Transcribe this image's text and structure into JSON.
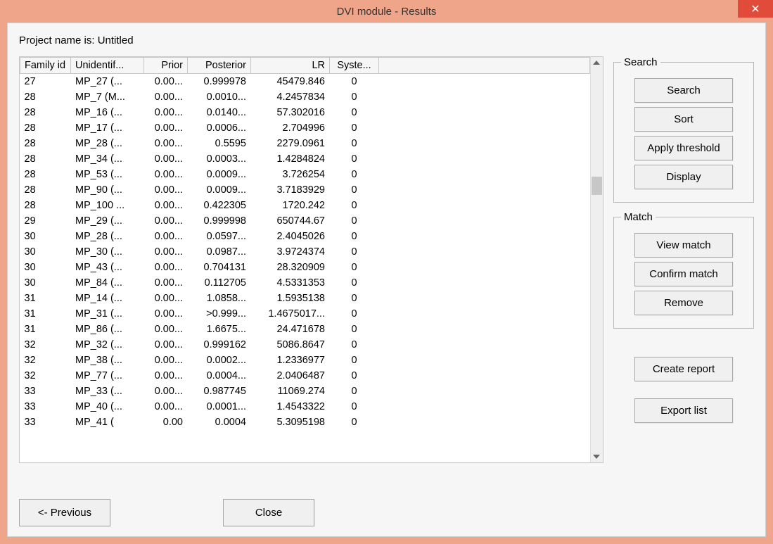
{
  "window": {
    "title": "DVI module - Results",
    "close_glyph": "✕"
  },
  "project_line": "Project name is: Untitled",
  "columns": {
    "family_id": "Family id",
    "unidentified": "Unidentif...",
    "prior": "Prior",
    "posterior": "Posterior",
    "lr": "LR",
    "system": "Syste..."
  },
  "rows": [
    {
      "fid": "27",
      "unid": "MP_27 (...",
      "prior": "0.00...",
      "post": "0.999978",
      "lr": "45479.846",
      "sys": "0"
    },
    {
      "fid": "28",
      "unid": "MP_7 (M...",
      "prior": "0.00...",
      "post": "0.0010...",
      "lr": "4.2457834",
      "sys": "0"
    },
    {
      "fid": "28",
      "unid": "MP_16 (...",
      "prior": "0.00...",
      "post": "0.0140...",
      "lr": "57.302016",
      "sys": "0"
    },
    {
      "fid": "28",
      "unid": "MP_17 (...",
      "prior": "0.00...",
      "post": "0.0006...",
      "lr": "2.704996",
      "sys": "0"
    },
    {
      "fid": "28",
      "unid": "MP_28 (...",
      "prior": "0.00...",
      "post": "0.5595",
      "lr": "2279.0961",
      "sys": "0"
    },
    {
      "fid": "28",
      "unid": "MP_34 (...",
      "prior": "0.00...",
      "post": "0.0003...",
      "lr": "1.4284824",
      "sys": "0"
    },
    {
      "fid": "28",
      "unid": "MP_53 (...",
      "prior": "0.00...",
      "post": "0.0009...",
      "lr": "3.726254",
      "sys": "0"
    },
    {
      "fid": "28",
      "unid": "MP_90 (...",
      "prior": "0.00...",
      "post": "0.0009...",
      "lr": "3.7183929",
      "sys": "0"
    },
    {
      "fid": "28",
      "unid": "MP_100 ...",
      "prior": "0.00...",
      "post": "0.422305",
      "lr": "1720.242",
      "sys": "0"
    },
    {
      "fid": "29",
      "unid": "MP_29 (...",
      "prior": "0.00...",
      "post": "0.999998",
      "lr": "650744.67",
      "sys": "0"
    },
    {
      "fid": "30",
      "unid": "MP_28 (...",
      "prior": "0.00...",
      "post": "0.0597...",
      "lr": "2.4045026",
      "sys": "0"
    },
    {
      "fid": "30",
      "unid": "MP_30 (...",
      "prior": "0.00...",
      "post": "0.0987...",
      "lr": "3.9724374",
      "sys": "0"
    },
    {
      "fid": "30",
      "unid": "MP_43 (...",
      "prior": "0.00...",
      "post": "0.704131",
      "lr": "28.320909",
      "sys": "0"
    },
    {
      "fid": "30",
      "unid": "MP_84 (...",
      "prior": "0.00...",
      "post": "0.112705",
      "lr": "4.5331353",
      "sys": "0"
    },
    {
      "fid": "31",
      "unid": "MP_14 (...",
      "prior": "0.00...",
      "post": "1.0858...",
      "lr": "1.5935138",
      "sys": "0"
    },
    {
      "fid": "31",
      "unid": "MP_31 (...",
      "prior": "0.00...",
      "post": ">0.999...",
      "lr": "1.4675017...",
      "sys": "0"
    },
    {
      "fid": "31",
      "unid": "MP_86 (...",
      "prior": "0.00...",
      "post": "1.6675...",
      "lr": "24.471678",
      "sys": "0"
    },
    {
      "fid": "32",
      "unid": "MP_32 (...",
      "prior": "0.00...",
      "post": "0.999162",
      "lr": "5086.8647",
      "sys": "0"
    },
    {
      "fid": "32",
      "unid": "MP_38 (...",
      "prior": "0.00...",
      "post": "0.0002...",
      "lr": "1.2336977",
      "sys": "0"
    },
    {
      "fid": "32",
      "unid": "MP_77 (...",
      "prior": "0.00...",
      "post": "0.0004...",
      "lr": "2.0406487",
      "sys": "0"
    },
    {
      "fid": "33",
      "unid": "MP_33 (...",
      "prior": "0.00...",
      "post": "0.987745",
      "lr": "11069.274",
      "sys": "0"
    },
    {
      "fid": "33",
      "unid": "MP_40 (...",
      "prior": "0.00...",
      "post": "0.0001...",
      "lr": "1.4543322",
      "sys": "0"
    },
    {
      "fid": "33",
      "unid": "MP_41 (",
      "prior": "0.00",
      "post": "0.0004",
      "lr": "5.3095198",
      "sys": "0"
    }
  ],
  "side": {
    "search": {
      "legend": "Search",
      "search_btn": "Search",
      "sort_btn": "Sort",
      "threshold_btn": "Apply threshold",
      "display_btn": "Display"
    },
    "match": {
      "legend": "Match",
      "view_btn": "View match",
      "confirm_btn": "Confirm match",
      "remove_btn": "Remove"
    },
    "create_report_btn": "Create report",
    "export_list_btn": "Export list"
  },
  "bottom": {
    "previous_btn": "<- Previous",
    "close_btn": "Close"
  }
}
